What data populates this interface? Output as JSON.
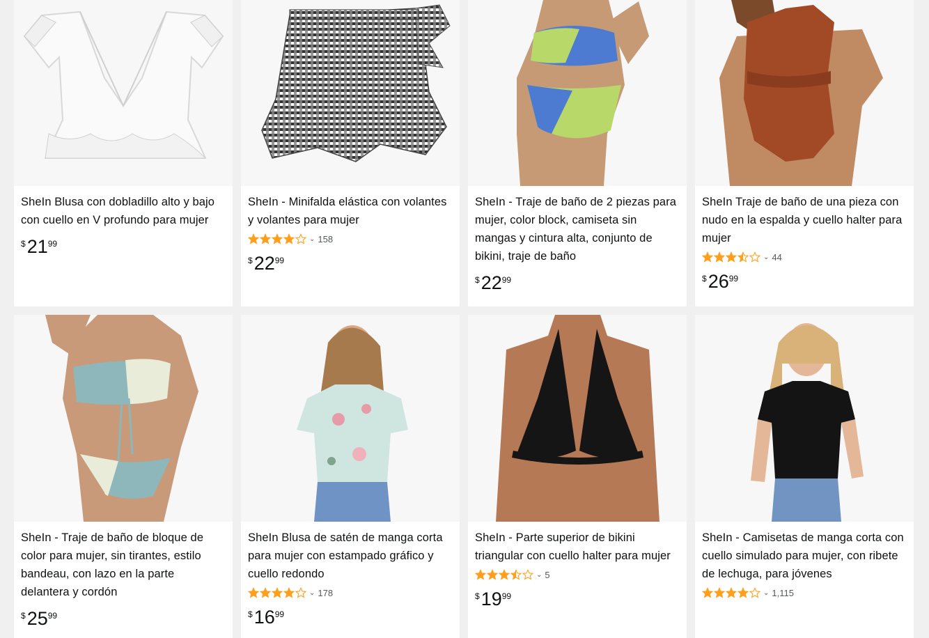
{
  "products": [
    {
      "title": "SheIn Blusa con dobladillo alto y bajo con cuello en V profundo para mujer",
      "rating": null,
      "reviews": null,
      "currency": "$",
      "price_whole": "21",
      "price_fraction": "99",
      "image": "white-ruffle-blouse"
    },
    {
      "title": "SheIn - Minifalda elástica con volantes y volantes para mujer",
      "rating": 4.0,
      "reviews": "158",
      "currency": "$",
      "price_whole": "22",
      "price_fraction": "99",
      "image": "gingham-wrap-skort"
    },
    {
      "title": "SheIn - Traje de baño de 2 piezas para mujer, color block, camiseta sin mangas y cintura alta, conjunto de bikini, traje de baño",
      "rating": null,
      "reviews": null,
      "currency": "$",
      "price_whole": "22",
      "price_fraction": "99",
      "image": "colorblock-bikini"
    },
    {
      "title": "SheIn Traje de baño de una pieza con nudo en la espalda y cuello halter para mujer",
      "rating": 3.5,
      "reviews": "44",
      "currency": "$",
      "price_whole": "26",
      "price_fraction": "99",
      "image": "rust-one-piece-swimsuit"
    },
    {
      "title": "SheIn - Traje de baño de bloque de color para mujer, sin tirantes, estilo bandeau, con lazo en la parte delantera y cordón",
      "rating": null,
      "reviews": null,
      "currency": "$",
      "price_whole": "25",
      "price_fraction": "99",
      "image": "bandeau-bikini"
    },
    {
      "title": "SheIn Blusa de satén de manga corta para mujer con estampado gráfico y cuello redondo",
      "rating": 4.0,
      "reviews": "178",
      "currency": "$",
      "price_whole": "16",
      "price_fraction": "99",
      "image": "floral-satin-blouse"
    },
    {
      "title": "SheIn - Parte superior de bikini triangular con cuello halter para mujer",
      "rating": 3.5,
      "reviews": "5",
      "currency": "$",
      "price_whole": "19",
      "price_fraction": "99",
      "image": "black-triangle-bikini-top"
    },
    {
      "title": "SheIn - Camisetas de manga corta con cuello simulado para mujer, con ribete de lechuga, para jóvenes",
      "rating": 4.0,
      "reviews": "1,115",
      "currency": "$",
      "price_whole": null,
      "price_fraction": null,
      "image": "black-mock-neck-tee"
    }
  ],
  "colors": {
    "star": "#ff9f1c",
    "text": "#0f1111",
    "muted": "#565959",
    "background": "#f0f0f0"
  }
}
